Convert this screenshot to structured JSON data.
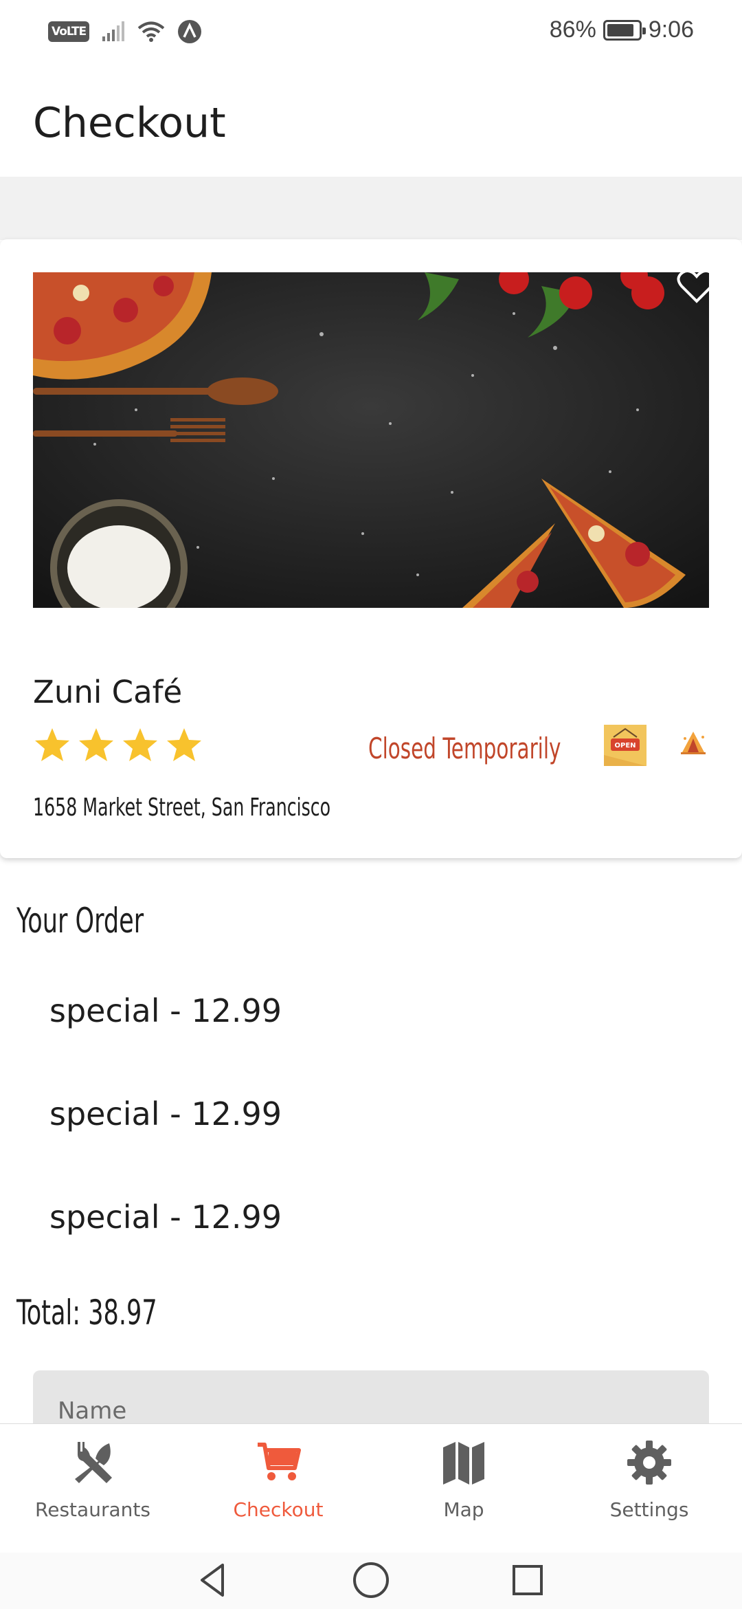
{
  "status_bar": {
    "network_badge": "VoLTE",
    "battery_percent": "86%",
    "battery_level": 0.86,
    "time": "9:06",
    "icons": [
      "signal-icon",
      "wifi-icon",
      "a-badge-icon",
      "battery-icon"
    ]
  },
  "app_bar": {
    "title": "Checkout"
  },
  "restaurant": {
    "name": "Zuni Café",
    "rating": 4,
    "rating_max": 4,
    "status": "Closed Temporarily",
    "address": "1658 Market Street, San Francisco",
    "open_sign_text": "OPEN",
    "icons": [
      "heart-outline-icon",
      "open-sign-icon",
      "camp-icon",
      "star-icon"
    ]
  },
  "order": {
    "heading": "Your Order",
    "items": [
      {
        "label": "special - 12.99"
      },
      {
        "label": "special - 12.99"
      },
      {
        "label": "special - 12.99"
      }
    ],
    "total": "Total: 38.97",
    "name_placeholder": "Name"
  },
  "bottom_nav": {
    "items": [
      {
        "label": "Restaurants",
        "icon": "fork-knife-icon"
      },
      {
        "label": "Checkout",
        "icon": "cart-icon"
      },
      {
        "label": "Map",
        "icon": "map-icon"
      },
      {
        "label": "Settings",
        "icon": "gear-icon"
      }
    ],
    "active_index": 1
  },
  "colors": {
    "accent": "#ef5a3c",
    "status_red": "#c1462a",
    "star_yellow": "#f8c22d",
    "inactive_gray": "#5f5f5f"
  }
}
